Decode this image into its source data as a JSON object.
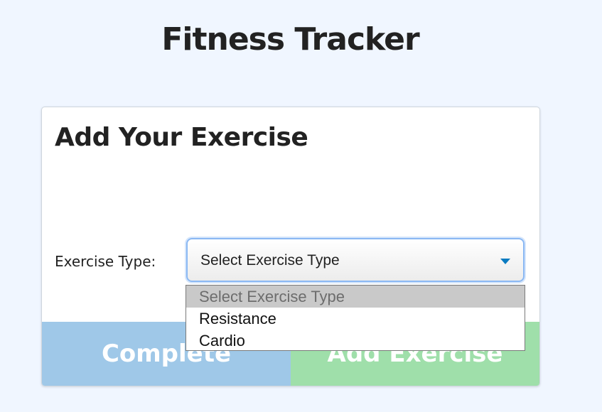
{
  "page": {
    "title": "Fitness Tracker"
  },
  "form": {
    "heading": "Add Your Exercise",
    "exercise_type_label": "Exercise Type:",
    "exercise_type_select": {
      "selected": "Select Exercise Type",
      "expanded": true,
      "options": [
        "Select Exercise Type",
        "Resistance",
        "Cardio"
      ]
    }
  },
  "buttons": {
    "complete_label": "Complete",
    "add_exercise_label": "Add Exercise"
  },
  "colors": {
    "background": "#f0f6ff",
    "complete_button": "#9fc8e8",
    "add_exercise_button": "#9fdfaa",
    "select_focus_ring": "#8ab8f3",
    "chevron": "#0a7bc1"
  }
}
